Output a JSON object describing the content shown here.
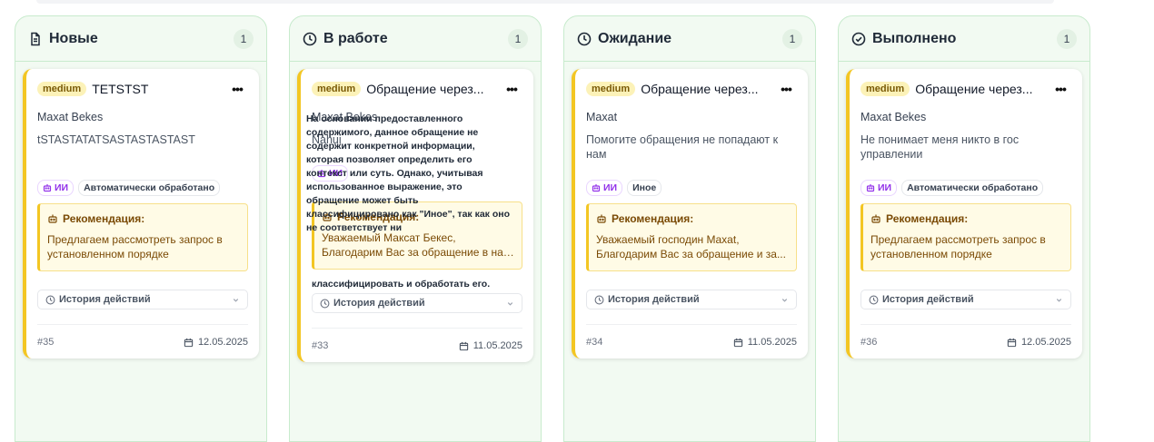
{
  "columns": [
    {
      "title": "Новые",
      "count": "1",
      "icon": "document-icon",
      "card": {
        "priority": "medium",
        "title": "TETSTST",
        "author": "Maxat Bekes",
        "description": "tSTASTATATSASTASTASTAST",
        "tags": [
          "ИИ",
          "Автоматически обработано"
        ],
        "recommendation_label": "Рекомендация:",
        "recommendation": "Предлагаем рассмотреть запрос в установленном порядке",
        "history": "История действий",
        "id": "#35",
        "date": "12.05.2025"
      }
    },
    {
      "title": "В работе",
      "count": "1",
      "icon": "clock-icon",
      "card": {
        "priority": "medium",
        "title": "Обращение через...",
        "author": "Maxat Bekes",
        "description": "Nahui",
        "ai_overlay": "На основании предоставленного содержимого, данное обращение не содержит конкретной информации, которая позволяет определить его контекст или суть. Однако, учитывая использованное выражение, это обращение может быть классифицировано как \"Иное\", так как оно не соответствует ни",
        "ai_overlay_tail": "классифицировать и обработать его.",
        "tags": [
          "ИИ"
        ],
        "recommendation_label": "Рекомендация:",
        "recommendation": "Уважаемый Максат Бекес, Благодарим Вас за обращение в наш сервис. Мы...",
        "history": "История действий",
        "id": "#33",
        "date": "11.05.2025"
      }
    },
    {
      "title": "Ожидание",
      "count": "1",
      "icon": "clock-icon",
      "card": {
        "priority": "medium",
        "title": "Обращение через...",
        "author": "Maxat",
        "description": "Помогите обращения не попадают к нам",
        "tags": [
          "ИИ",
          "Иное"
        ],
        "recommendation_label": "Рекомендация:",
        "recommendation": "Уважаемый господин Maxat, Благодарим Вас за обращение и за...",
        "history": "История действий",
        "id": "#34",
        "date": "11.05.2025"
      }
    },
    {
      "title": "Выполнено",
      "count": "1",
      "icon": "check-circle-icon",
      "card": {
        "priority": "medium",
        "title": "Обращение через...",
        "author": "Maxat Bekes",
        "description": "Не понимает меня никто в гос управлении",
        "tags": [
          "ИИ",
          "Автоматически обработано"
        ],
        "recommendation_label": "Рекомендация:",
        "recommendation": "Предлагаем рассмотреть запрос в установленном порядке",
        "history": "История действий",
        "id": "#36",
        "date": "12.05.2025"
      }
    }
  ],
  "colors": {
    "accent": "#f3c623",
    "column_bg": "#f2faf2",
    "column_border": "#c8ebcd",
    "ai_tag": "#9333ea"
  }
}
